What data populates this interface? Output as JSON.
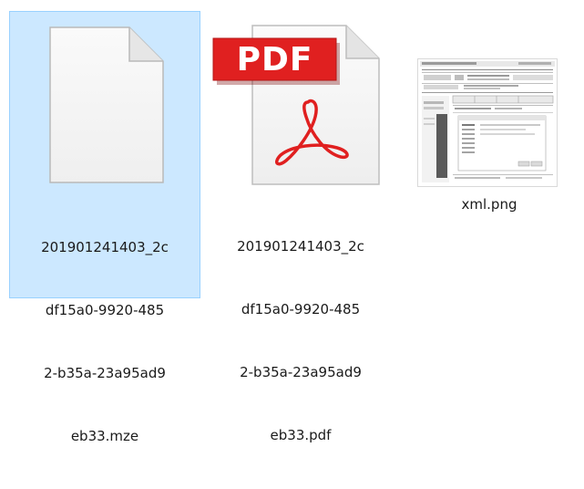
{
  "files": [
    {
      "name": "201901241403_2cdf15a0-9920-4852-b35a-23a95ad9eb33.mze",
      "name_lines": [
        "201901241403_2c",
        "df15a0-9920-485",
        "2-b35a-23a95ad9",
        "eb33.mze"
      ],
      "icon": "blank-document-icon",
      "selected": true
    },
    {
      "name": "201901241403_2cdf15a0-9920-4852-b35a-23a95ad9eb33.pdf",
      "name_lines": [
        "201901241403_2c",
        "df15a0-9920-485",
        "2-b35a-23a95ad9",
        "eb33.pdf"
      ],
      "icon": "pdf-file-icon",
      "badge": "PDF",
      "selected": false
    },
    {
      "name": "xml.png",
      "name_lines": [
        "xml.png"
      ],
      "icon": "image-thumbnail-icon",
      "selected": false
    }
  ],
  "colors": {
    "selection_bg": "#cce8ff",
    "selection_border": "#99d1ff",
    "pdf_red": "#e02020",
    "text": "#1a1a1a"
  }
}
